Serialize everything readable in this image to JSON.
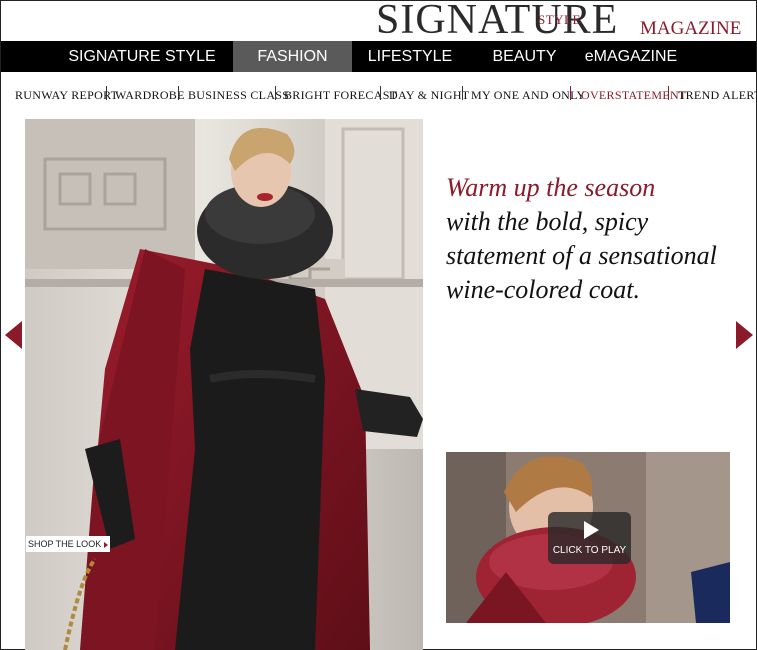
{
  "brand": {
    "signature": "SIGNATURE",
    "style": "STYLE",
    "magazine": "MAGAZINE"
  },
  "main_nav": [
    {
      "label": "SIGNATURE STYLE",
      "active": false
    },
    {
      "label": "FASHION",
      "active": true
    },
    {
      "label": "LIFESTYLE",
      "active": false
    },
    {
      "label": "BEAUTY",
      "active": false
    },
    {
      "label": "eMAGAZINE",
      "active": false
    }
  ],
  "sub_nav": [
    {
      "label": "RUNWAY REPORT",
      "active": false
    },
    {
      "label": "WARDROBE",
      "active": false
    },
    {
      "label": "BUSINESS CLASS",
      "active": false
    },
    {
      "label": "BRIGHT FORECAST",
      "active": false
    },
    {
      "label": "DAY & NIGHT",
      "active": false
    },
    {
      "label": "MY ONE AND ONLY",
      "active": false
    },
    {
      "label": "OVERSTATEMENT",
      "active": true
    },
    {
      "label": "TREND ALERT",
      "active": false
    }
  ],
  "hero": {
    "shop_label": "SHOP THE LOOK"
  },
  "headline": {
    "accent": "Warm up the season",
    "line2": "with the bold, spicy",
    "line3": "statement of a sensational",
    "line4": "wine-colored coat."
  },
  "video": {
    "play_label": "CLICK TO PLAY"
  },
  "icons": {
    "prev": "arrow-left-icon",
    "next": "arrow-right-icon",
    "play": "play-icon"
  },
  "colors": {
    "accent": "#8b1a2a",
    "nav_bg": "#000000",
    "nav_active": "#5a5a5a"
  }
}
